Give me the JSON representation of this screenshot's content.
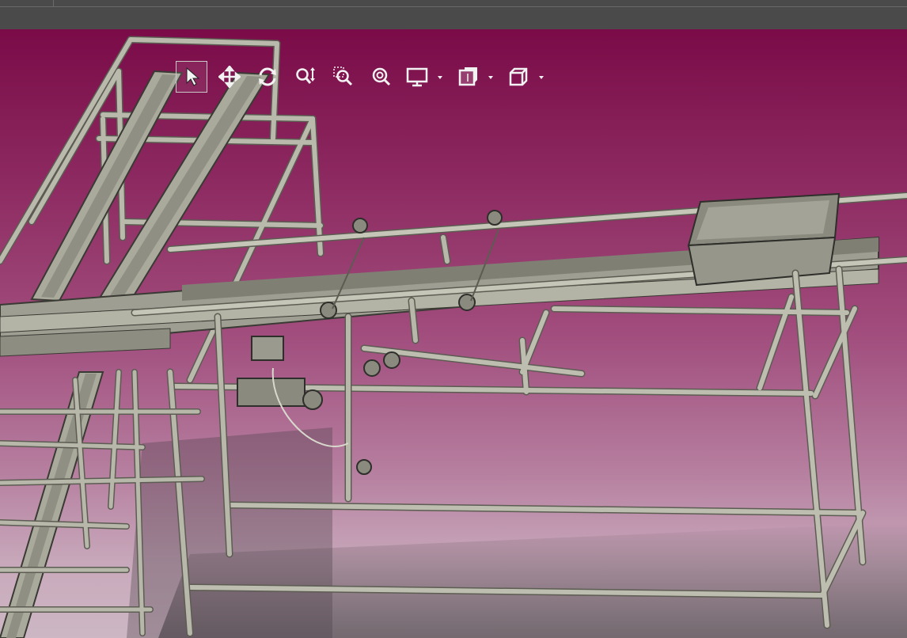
{
  "app": {
    "title": "",
    "tabs": []
  },
  "viewport": {
    "background_top": "#7a0b48",
    "background_bottom": "#cdb7c4",
    "model": "conveyor-frame-assembly"
  },
  "toolbar": {
    "tools": [
      {
        "id": "select",
        "icon": "arrow-pointer-icon",
        "active": true
      },
      {
        "id": "pan",
        "icon": "four-way-move-icon",
        "active": false
      },
      {
        "id": "rotate",
        "icon": "rotate-icon",
        "active": false
      },
      {
        "id": "zoom",
        "icon": "zoom-updown-icon",
        "active": false
      },
      {
        "id": "zoom-window",
        "icon": "zoom-window-icon",
        "active": false
      },
      {
        "id": "zoom-fit",
        "icon": "zoom-fit-icon",
        "active": false
      },
      {
        "id": "display-mode",
        "icon": "monitor-icon",
        "dropdown": true
      },
      {
        "id": "section-view",
        "icon": "section-view-icon",
        "dropdown": true
      },
      {
        "id": "view-orientation",
        "icon": "cube-icon",
        "dropdown": true
      }
    ]
  }
}
